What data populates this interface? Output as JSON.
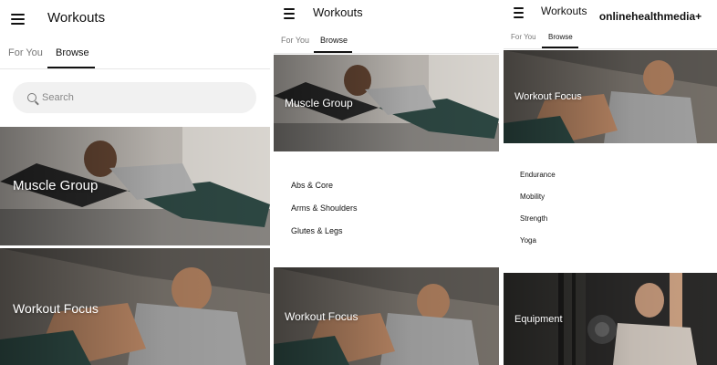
{
  "colors": {
    "accent": "#111111",
    "inactive_tab": "#777777",
    "search_bg": "#f1f1f1",
    "card_text": "#ffffff"
  },
  "screens": [
    {
      "title": "Workouts",
      "tabs": [
        "For You",
        "Browse"
      ],
      "active_tab": "Browse",
      "search": {
        "placeholder": "Search",
        "value": ""
      },
      "cards": [
        "Muscle Group",
        "Workout Focus"
      ]
    },
    {
      "title": "Workouts",
      "tabs": [
        "For You",
        "Browse"
      ],
      "active_tab": "Browse",
      "cards": [
        "Muscle Group",
        "Workout Focus"
      ],
      "submenu": [
        "Abs & Core",
        "Arms & Shoulders",
        "Glutes & Legs"
      ]
    },
    {
      "title": "Workouts",
      "tabs": [
        "For You",
        "Browse"
      ],
      "active_tab": "Browse",
      "cards": [
        "Workout Focus",
        "Equipment"
      ],
      "submenu": [
        "Endurance",
        "Mobility",
        "Strength",
        "Yoga"
      ]
    }
  ],
  "watermark": "onlinehealthmedia+",
  "icons": [
    "menu-icon",
    "search-icon"
  ]
}
